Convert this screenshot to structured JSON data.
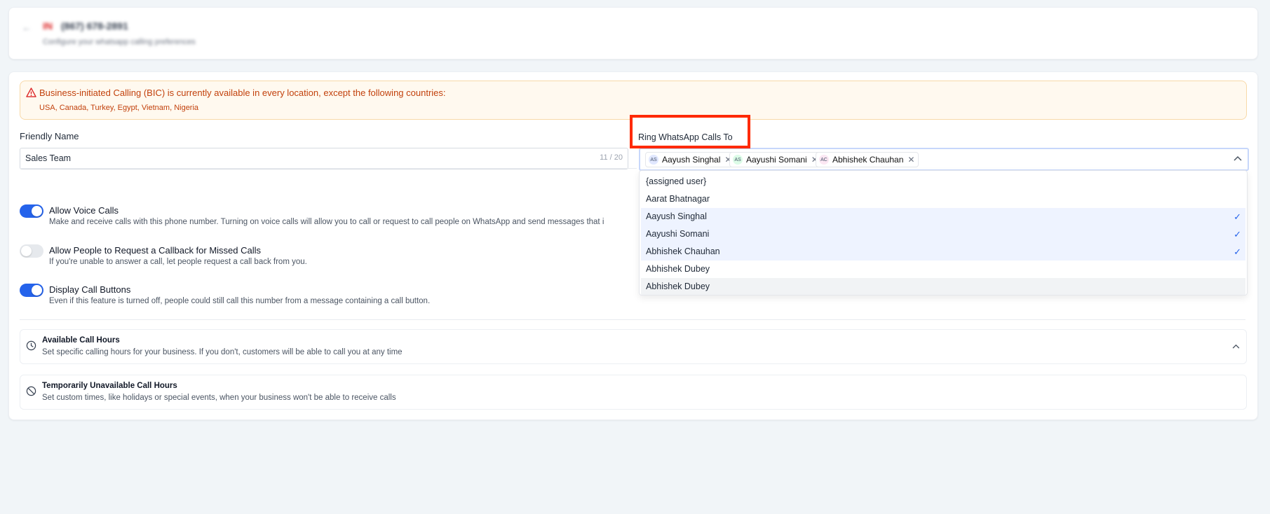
{
  "header": {
    "flag_text": "IN",
    "phone": "(867) 678-2891",
    "subtitle": "Configure your whatsapp calling preferences"
  },
  "warning": {
    "title": "Business-initiated Calling (BIC) is currently available in every location, except the following countries:",
    "countries": "USA, Canada, Turkey, Egypt, Vietnam, Nigeria"
  },
  "friendly_name": {
    "label": "Friendly Name",
    "value": "Sales Team",
    "counter": "11 / 20"
  },
  "ring_to": {
    "label": "Ring WhatsApp Calls To",
    "chips": [
      {
        "initials": "AS",
        "name": "Aayush Singhal"
      },
      {
        "initials": "AS",
        "name": "Aayushi Somani"
      },
      {
        "initials": "AC",
        "name": "Abhishek Chauhan"
      }
    ],
    "options": [
      {
        "label": "{assigned user}",
        "selected": false
      },
      {
        "label": "Aarat Bhatnagar",
        "selected": false
      },
      {
        "label": "Aayush Singhal",
        "selected": true
      },
      {
        "label": "Aayushi Somani",
        "selected": true
      },
      {
        "label": "Abhishek Chauhan",
        "selected": true
      },
      {
        "label": "Abhishek Dubey",
        "selected": false
      },
      {
        "label": "Abhishek Dubey",
        "selected": false
      }
    ]
  },
  "settings": [
    {
      "title": "Allow Voice Calls",
      "desc": "Make and receive calls with this phone number. Turning on voice calls will allow you to call or request to call people on WhatsApp and send messages that i",
      "enabled": true
    },
    {
      "title": "Allow People to Request a Callback for Missed Calls",
      "desc": "If you're unable to answer a call, let people request a call back from you.",
      "enabled": false
    },
    {
      "title": "Display Call Buttons",
      "desc": "Even if this feature is turned off, people could still call this number from a message containing a call button.",
      "enabled": true
    }
  ],
  "sections": [
    {
      "title": "Available Call Hours",
      "desc": "Set specific calling hours for your business. If you don't, customers will be able to call you at any time",
      "icon": "clock-icon"
    },
    {
      "title": "Temporarily Unavailable Call Hours",
      "desc": "Set custom times, like holidays or special events, when your business won't be able to receive calls",
      "icon": "block-icon"
    }
  ],
  "colors": {
    "accent": "#2563eb",
    "warning": "#c2410c",
    "highlight": "#ff2a00"
  }
}
